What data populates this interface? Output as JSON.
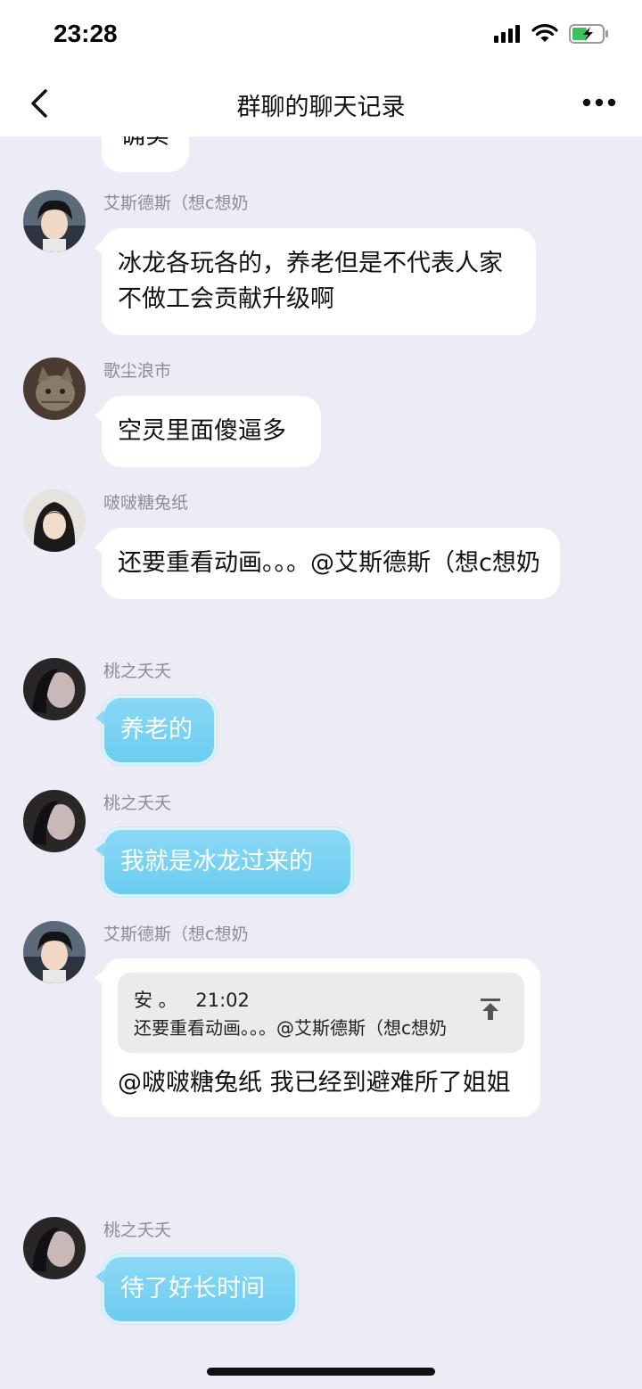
{
  "status": {
    "time": "23:28",
    "icons": [
      "signal-icon",
      "wifi-icon",
      "battery-charging-icon"
    ]
  },
  "nav": {
    "title": "群聊的聊天记录",
    "back_icon": "chevron-left-icon",
    "more_icon": "more-dots-icon"
  },
  "messages": [
    {
      "text_partial": "确实"
    },
    {
      "sender": "艾斯德斯（想c想奶",
      "text": "冰龙各玩各的，养老但是不代表人家不做工会贡献升级啊",
      "style": "white"
    },
    {
      "sender": "歌尘浪市",
      "text": "空灵里面傻逼多",
      "style": "white"
    },
    {
      "sender": "啵啵糖兔纸",
      "text": "还要重看动画。。。@艾斯德斯（想c想奶",
      "style": "white"
    },
    {
      "sender": "桃之夭夭",
      "text": "养老的",
      "style": "blue"
    },
    {
      "sender": "桃之夭夭",
      "text": "我就是冰龙过来的",
      "style": "blue"
    },
    {
      "sender": "艾斯德斯（想c想奶",
      "quote": {
        "author": "安 。",
        "time": "21:02",
        "text": "还要重看动画。。。@艾斯德斯（想c想奶"
      },
      "text": "@啵啵糖兔纸 我已经到避难所了姐姐",
      "style": "white"
    },
    {
      "sender": "桃之夭夭",
      "text": "待了好长时间",
      "style": "blue"
    }
  ],
  "colors": {
    "background": "#ecebf6",
    "bubble_white": "#ffffff",
    "bubble_blue": "#7bd3f3",
    "sender_gray": "#8c8c96"
  }
}
